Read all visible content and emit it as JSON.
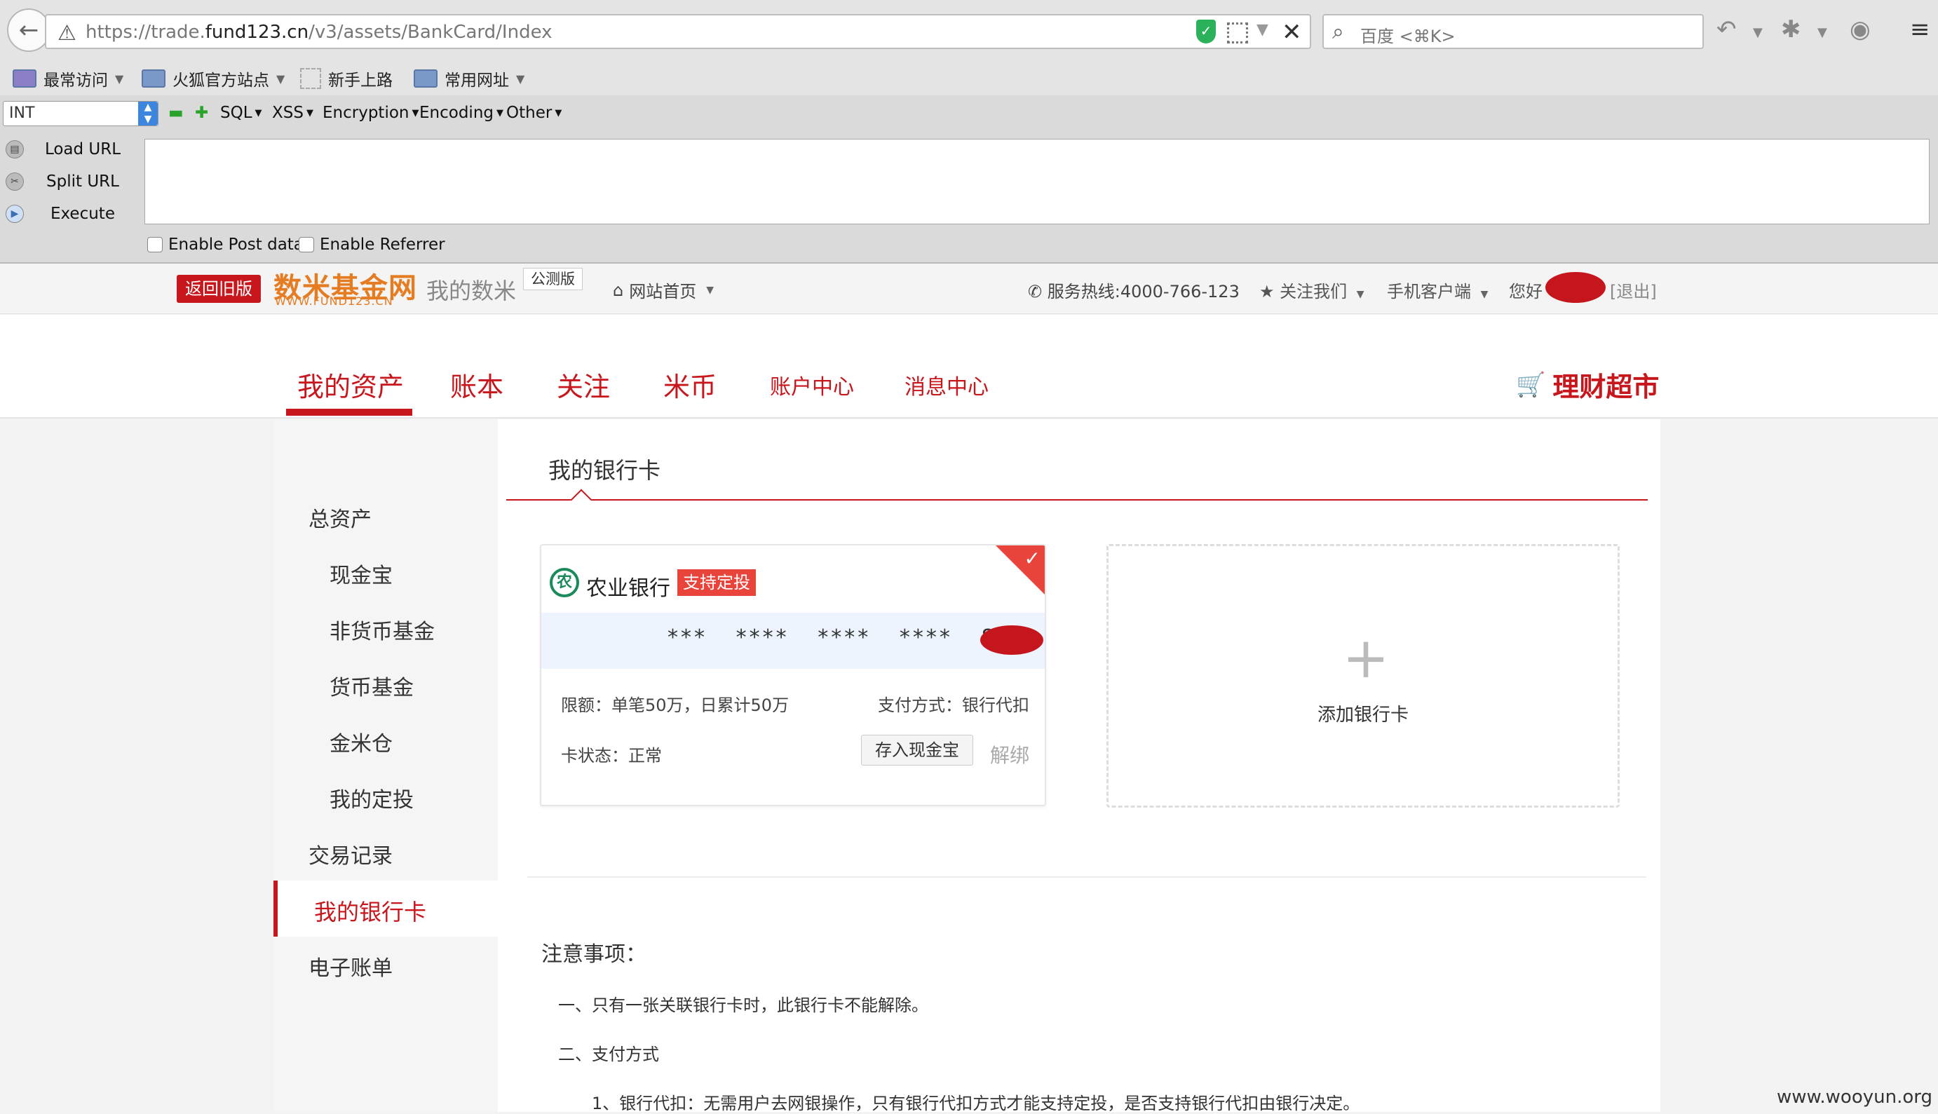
{
  "browser": {
    "url_prefix": "https://trade.",
    "url_domain": "fund123.cn",
    "url_path": "/v3/assets/BankCard/Index",
    "search_placeholder": "百度 <⌘K>",
    "bookmarks": [
      "最常访问",
      "火狐官方站点",
      "新手上路",
      "常用网址"
    ]
  },
  "hackbar": {
    "select_value": "INT",
    "menus": [
      "SQL",
      "XSS",
      "Encryption",
      "Encoding",
      "Other"
    ],
    "actions": [
      "Load URL",
      "Split URL",
      "Execute"
    ],
    "checks": [
      "Enable Post data",
      "Enable Referrer"
    ]
  },
  "site_header": {
    "old_version": "返回旧版",
    "logo": "数米基金网",
    "logo_sub": "WWW.FUND123.CN",
    "my_shumi": "我的数米",
    "beta": "公测版",
    "home": "网站首页",
    "hotline": "服务热线:4000-766-123",
    "follow": "关注我们",
    "mobile": "手机客户端",
    "hello": "您好",
    "logout": "[退出]"
  },
  "nav": {
    "tabs": [
      "我的资产",
      "账本",
      "关注",
      "米币",
      "账户中心",
      "消息中心"
    ],
    "market": "理财超市"
  },
  "sidebar": {
    "items": [
      "总资产",
      "现金宝",
      "非货币基金",
      "货币基金",
      "金米仓",
      "我的定投",
      "交易记录",
      "我的银行卡",
      "电子账单"
    ]
  },
  "content": {
    "title": "我的银行卡",
    "card": {
      "bank_name": "农业银行",
      "tag": "支持定投",
      "number": "***   ****   ****   ****   8",
      "limit": "限额：单笔50万，日累计50万",
      "pay_method": "支付方式：银行代扣",
      "status": "卡状态：正常",
      "deposit_btn": "存入现金宝",
      "unbind": "解绑"
    },
    "add_card": "添加银行卡",
    "notice_title": "注意事项：",
    "notices": [
      "一、只有一张关联银行卡时，此银行卡不能解除。",
      "二、支付方式",
      "1、银行代扣：无需用户去网银操作，只有银行代扣方式才能支持定投，是否支持银行代扣由银行决定。"
    ]
  },
  "watermark": "www.wooyun.org",
  "colors": {
    "brand_red": "#c8161d",
    "tag_red": "#e8443c",
    "logo_orange": "#e57c22"
  }
}
